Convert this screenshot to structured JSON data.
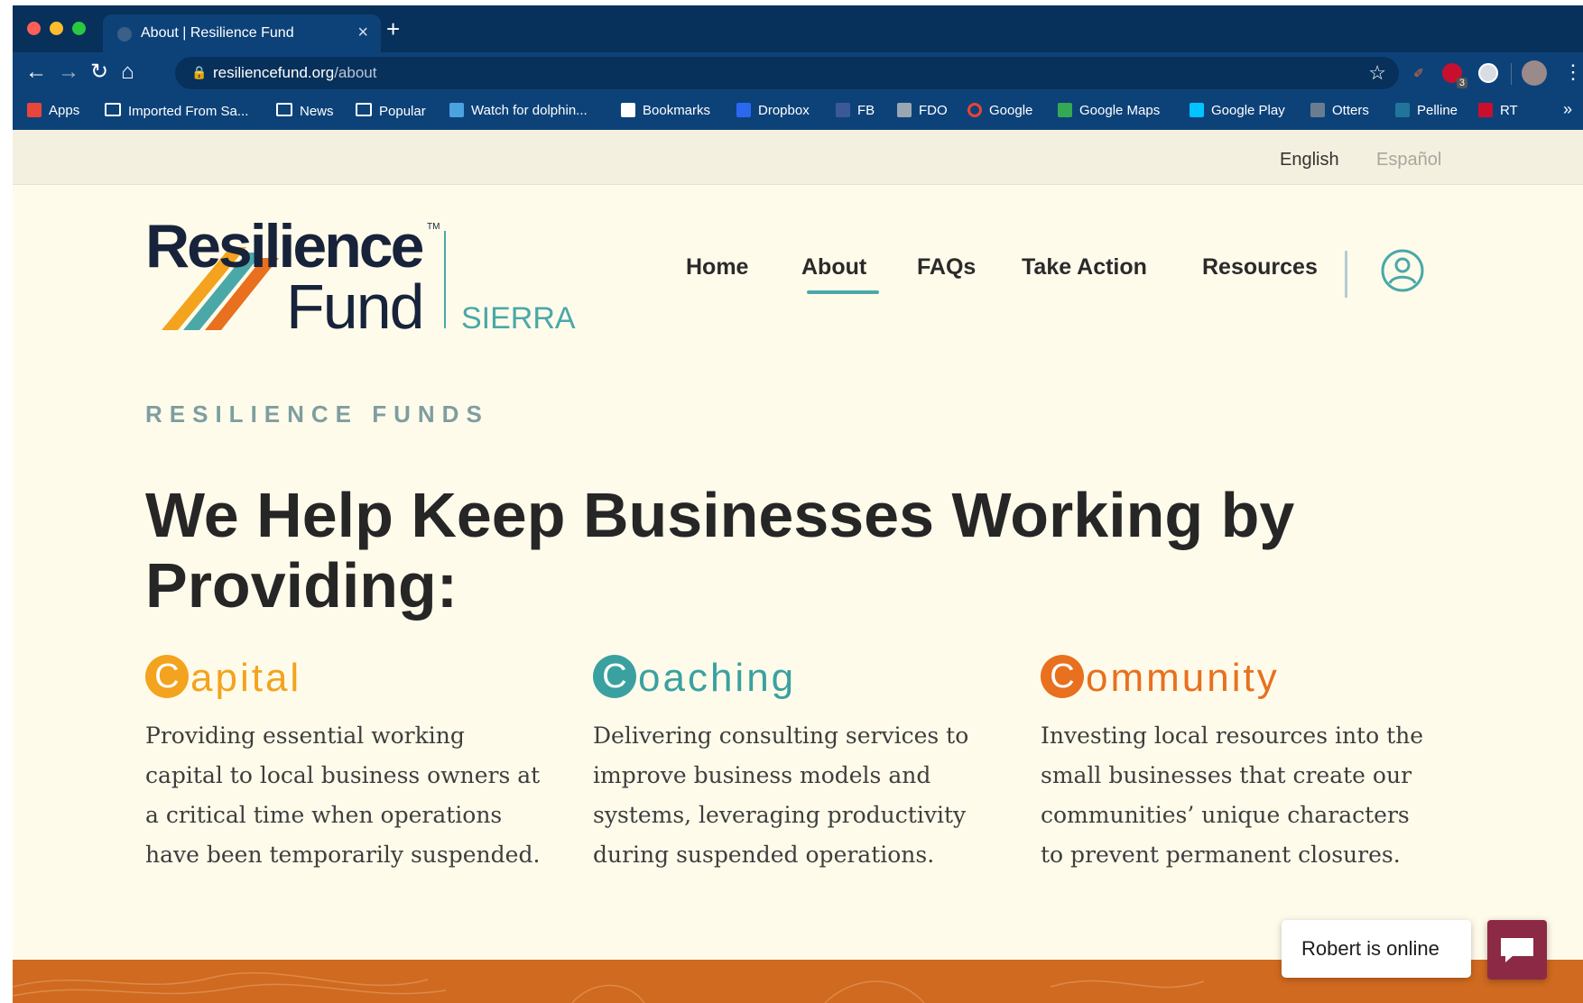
{
  "browser": {
    "tab_title": "About | Resilience Fund",
    "tab_close": "×",
    "new_tab": "+",
    "url_host": "resiliencefund.org",
    "url_path": "/about",
    "nav": {
      "back": "←",
      "forward": "→",
      "reload": "↻",
      "home": "⌂"
    },
    "more": "⋮",
    "extensions_badge": "3",
    "bookmarks": [
      {
        "label": "Apps",
        "icon": "apps-grid-icon",
        "color": "#e8453c"
      },
      {
        "label": "Imported From Sa...",
        "icon": "folder-icon",
        "color": "#ffffff"
      },
      {
        "label": "News",
        "icon": "folder-icon",
        "color": "#ffffff"
      },
      {
        "label": "Popular",
        "icon": "folder-icon",
        "color": "#ffffff"
      },
      {
        "label": "Watch for dolphin...",
        "icon": "dolphin-icon",
        "color": "#4aa3df"
      },
      {
        "label": "Bookmarks",
        "icon": "star-icon",
        "color": "#ffffff"
      },
      {
        "label": "Dropbox",
        "icon": "dropbox-icon",
        "color": "#2b68f0"
      },
      {
        "label": "FB",
        "icon": "facebook-icon",
        "color": "#3b5998"
      },
      {
        "label": "FDO",
        "icon": "fdo-icon",
        "color": "#9aa7b3"
      },
      {
        "label": "Google",
        "icon": "google-icon",
        "color": "#ffffff"
      },
      {
        "label": "Google Maps",
        "icon": "google-maps-icon",
        "color": "#34a853"
      },
      {
        "label": "Google Play",
        "icon": "google-play-icon",
        "color": "#00c4ff"
      },
      {
        "label": "Otters",
        "icon": "otter-icon",
        "color": "#6a7d8f"
      },
      {
        "label": "Pelline",
        "icon": "wordpress-icon",
        "color": "#21759b"
      },
      {
        "label": "RT",
        "icon": "rt-icon",
        "color": "#c8102e"
      }
    ],
    "bookmarks_overflow": "»"
  },
  "page": {
    "lang": {
      "english": "English",
      "espanol": "Español"
    },
    "logo": {
      "line1": "Resilience",
      "line2": "Fund",
      "tm": "TM",
      "region": "SIERRA"
    },
    "nav": [
      "Home",
      "About",
      "FAQs",
      "Take Action",
      "Resources"
    ],
    "active_nav": "About",
    "eyebrow": "RESILIENCE FUNDS",
    "headline": "We Help Keep Businesses Working by Providing:",
    "columns": [
      {
        "letter": "C",
        "rest": "apital",
        "color": "#f3a31d",
        "body": "Providing essential working capital to local business owners at a critical time when operations have been temporarily suspended."
      },
      {
        "letter": "C",
        "rest": "oaching",
        "color": "#3aa1a0",
        "body": "Delivering consulting services to improve business models and systems, leveraging productivity during suspended operations."
      },
      {
        "letter": "C",
        "rest": "ommunity",
        "color": "#e8701e",
        "body": "Investing local resources into the small businesses that create our communities’ unique characters to prevent permanent closures."
      }
    ],
    "chat": {
      "status": "Robert is online"
    }
  },
  "colors": {
    "brand_orange": "#d06a20",
    "brand_teal": "#4aa8a8",
    "brand_yellow": "#f3a31d",
    "chat_maroon": "#8c2a46",
    "chrome_navy": "#0d4279"
  }
}
